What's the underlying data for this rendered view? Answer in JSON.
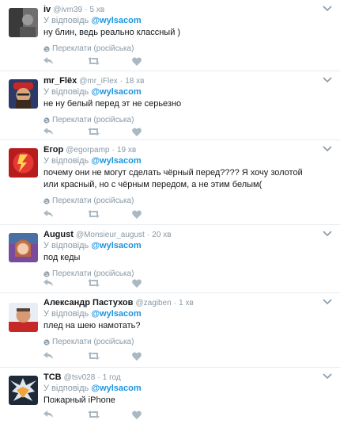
{
  "translate_label": "Переклати (російська)",
  "reply_prefix": "У відповідь",
  "icons": {
    "reply": "reply-icon",
    "retweet": "retweet-icon",
    "like": "heart-icon",
    "more": "chevron-down-icon",
    "translate": "globe-icon"
  },
  "colors": {
    "mention": "#1b95e0",
    "muted": "#8899a6",
    "text": "#14171a"
  },
  "tweets": [
    {
      "name": "iv",
      "handle": "@ivm39",
      "time": "5 хв",
      "mention": "@wylsacom",
      "text": "ну блин, ведь реально классный )"
    },
    {
      "name": "mr_Flëx",
      "handle": "@mr_iFlex",
      "time": "18 хв",
      "mention": "@wylsacom",
      "text": "не ну белый перед эт не серьезно"
    },
    {
      "name": "Егор",
      "handle": "@egorpamp",
      "time": "19 хв",
      "mention": "@wylsacom",
      "text": "почему они не могут сделать чёрный перед???? Я хочу золотой или красный, но с чёрным передом, а не этим белым("
    },
    {
      "name": "August",
      "handle": "@Monsieur_august",
      "time": "20 хв",
      "mention": "@wylsacom",
      "text": "под кеды"
    },
    {
      "name": "Александр Пастухов",
      "handle": "@zagiben",
      "time": "1 хв",
      "mention": "@wylsacom",
      "text": "плед на шею намотать?"
    },
    {
      "name": "TCB",
      "handle": "@tsv028",
      "time": "1 год",
      "mention": "@wylsacom",
      "text": "Пожарный iPhone"
    }
  ]
}
